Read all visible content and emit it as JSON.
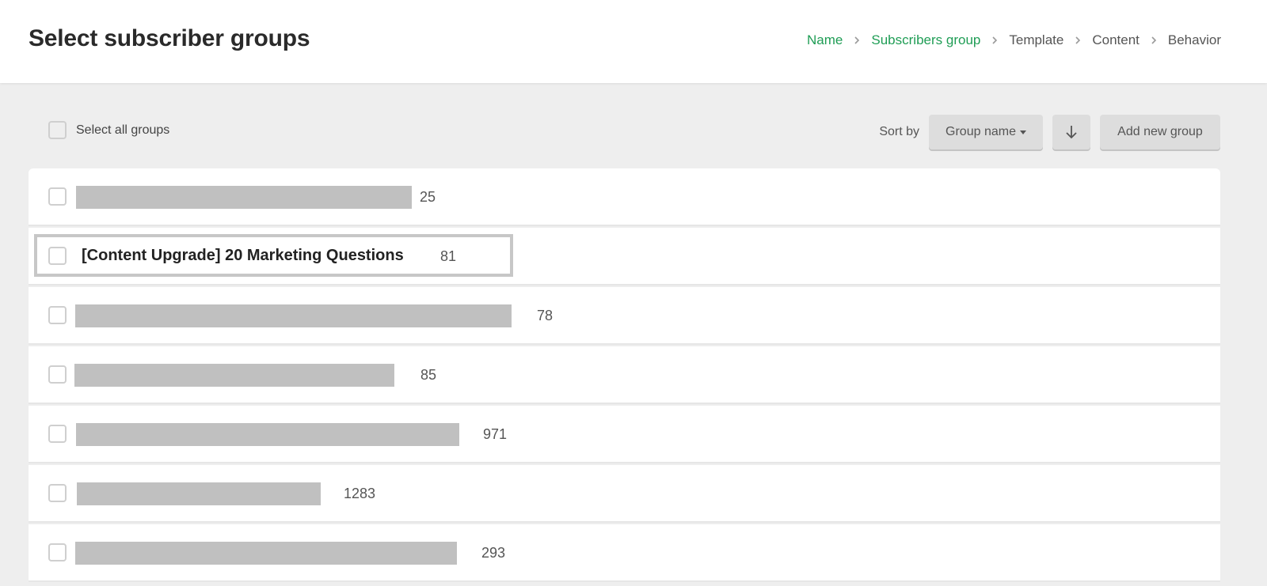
{
  "header": {
    "title": "Select subscriber groups",
    "breadcrumb": [
      {
        "label": "Name",
        "state": "done"
      },
      {
        "label": "Subscribers group",
        "state": "done"
      },
      {
        "label": "Template",
        "state": "todo"
      },
      {
        "label": "Content",
        "state": "todo"
      },
      {
        "label": "Behavior",
        "state": "todo"
      }
    ],
    "breadcrumb_done_color": "#1f9d55",
    "breadcrumb_sep_icon": "chevron-right-icon"
  },
  "toolbar": {
    "select_all_label": "Select all groups",
    "sort_label": "Sort by",
    "sort_value": "Group name",
    "sort_direction_icon": "arrow-down-icon",
    "add_group_label": "Add new group"
  },
  "groups": [
    {
      "name": "",
      "redacted": true,
      "count": "25"
    },
    {
      "name": "[Content Upgrade] 20 Marketing Questions",
      "redacted": false,
      "count": "81",
      "highlighted": true
    },
    {
      "name": "",
      "redacted": true,
      "count": "78"
    },
    {
      "name": "",
      "redacted": true,
      "count": "85"
    },
    {
      "name": "",
      "redacted": true,
      "count": "971"
    },
    {
      "name": "",
      "redacted": true,
      "count": "1283"
    },
    {
      "name": "",
      "redacted": true,
      "count": "293"
    }
  ]
}
